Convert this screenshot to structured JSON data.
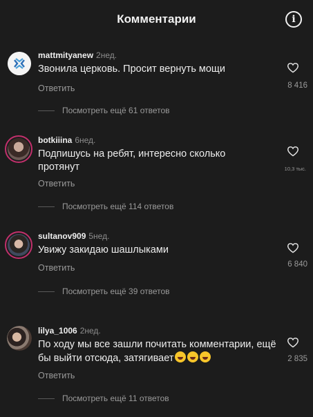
{
  "header": {
    "title": "Комментарии",
    "info_icon": "info-icon"
  },
  "comments": [
    {
      "username": "mattmityanew",
      "time": "2нед.",
      "text": "Звонила церковь. Просит вернуть мощи",
      "reply_label": "Ответить",
      "likes": "8 416",
      "thread": "Посмотреть ещё 61 ответов",
      "avatar": "logo-avatar"
    },
    {
      "username": "botkiiina",
      "time": "6нед.",
      "text": "Подпишусь на ребят, интересно сколько протянут",
      "reply_label": "Ответить",
      "likes": "10,3 тыс.",
      "thread": "Посмотреть ещё 114 ответов",
      "avatar": "photo-avatar"
    },
    {
      "username": "sultanov909",
      "time": "5нед.",
      "text": "Увижу закидаю шашлыками",
      "reply_label": "Ответить",
      "likes": "6 840",
      "thread": "Посмотреть ещё 39 ответов",
      "avatar": "photo-avatar"
    },
    {
      "username": "lilya_1006",
      "time": "2нед.",
      "text": "По ходу мы все зашли почитать комментарии, ещё бы выйти отсюда,  затягивает",
      "reply_label": "Ответить",
      "likes": "2 835",
      "thread": "Посмотреть ещё 11 ответов",
      "avatar": "photo-avatar",
      "emoji": "laughing-emoji x3"
    }
  ],
  "colors": {
    "background": "#1c1c1c",
    "text": "#ededed",
    "muted": "#9a9a9a",
    "story_ring": "#c2306c"
  }
}
